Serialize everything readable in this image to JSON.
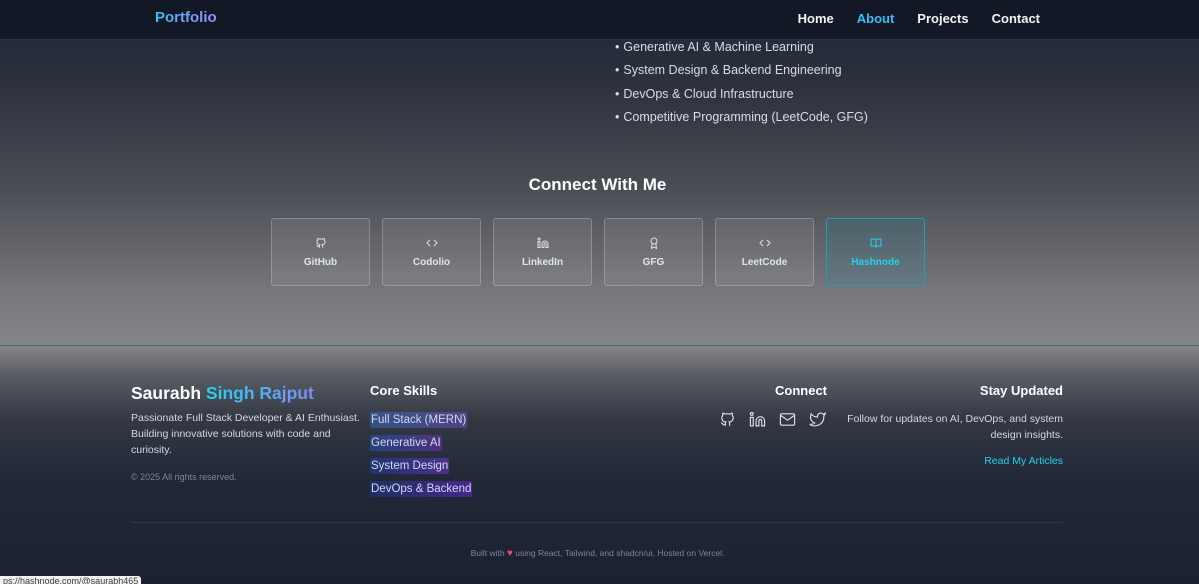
{
  "nav": {
    "brand": "Portfolio",
    "links": [
      "Home",
      "About",
      "Projects",
      "Contact"
    ],
    "active": "About"
  },
  "about": {
    "interests": [
      "Generative AI & Machine Learning",
      "System Design & Backend Engineering",
      "DevOps & Cloud Infrastructure",
      "Competitive Programming (LeetCode, GFG)"
    ],
    "bullet_char": "•"
  },
  "connect": {
    "title": "Connect With Me",
    "cards": [
      {
        "label": "GitHub",
        "icon": "github-icon"
      },
      {
        "label": "Codolio",
        "icon": "code-icon"
      },
      {
        "label": "LinkedIn",
        "icon": "linkedin-icon"
      },
      {
        "label": "GFG",
        "icon": "award-icon"
      },
      {
        "label": "LeetCode",
        "icon": "code-icon"
      },
      {
        "label": "Hashnode",
        "icon": "book-open-icon"
      }
    ],
    "highlighted": "Hashnode"
  },
  "footer": {
    "name_first": "Saurabh",
    "name_accent": "Singh Rajput",
    "description": "Passionate Full Stack Developer & AI Enthusiast. Building innovative solutions with code and curiosity.",
    "copyright": "© 2025 All rights reserved.",
    "skills_title": "Core Skills",
    "skills": [
      "Full Stack (MERN)",
      "Generative AI",
      "System Design",
      "DevOps & Backend"
    ],
    "connect_title": "Connect",
    "social_icons": [
      "github-icon",
      "linkedin-icon",
      "mail-icon",
      "twitter-icon"
    ],
    "stay_title": "Stay Updated",
    "stay_text": "Follow for updates on AI, DevOps, and system design insights.",
    "articles_link": "Read My Articles",
    "built_prefix": "Built with",
    "built_heart": "♥",
    "built_suffix": "using React, Tailwind, and shadcn/ui. Hosted on Vercel."
  },
  "status_bar": {
    "url": "ps://hashnode.com/@saurabh465"
  },
  "colors": {
    "accent": "#22d3ee",
    "nav_active": "#38bdf8",
    "heart": "#ef476f"
  }
}
